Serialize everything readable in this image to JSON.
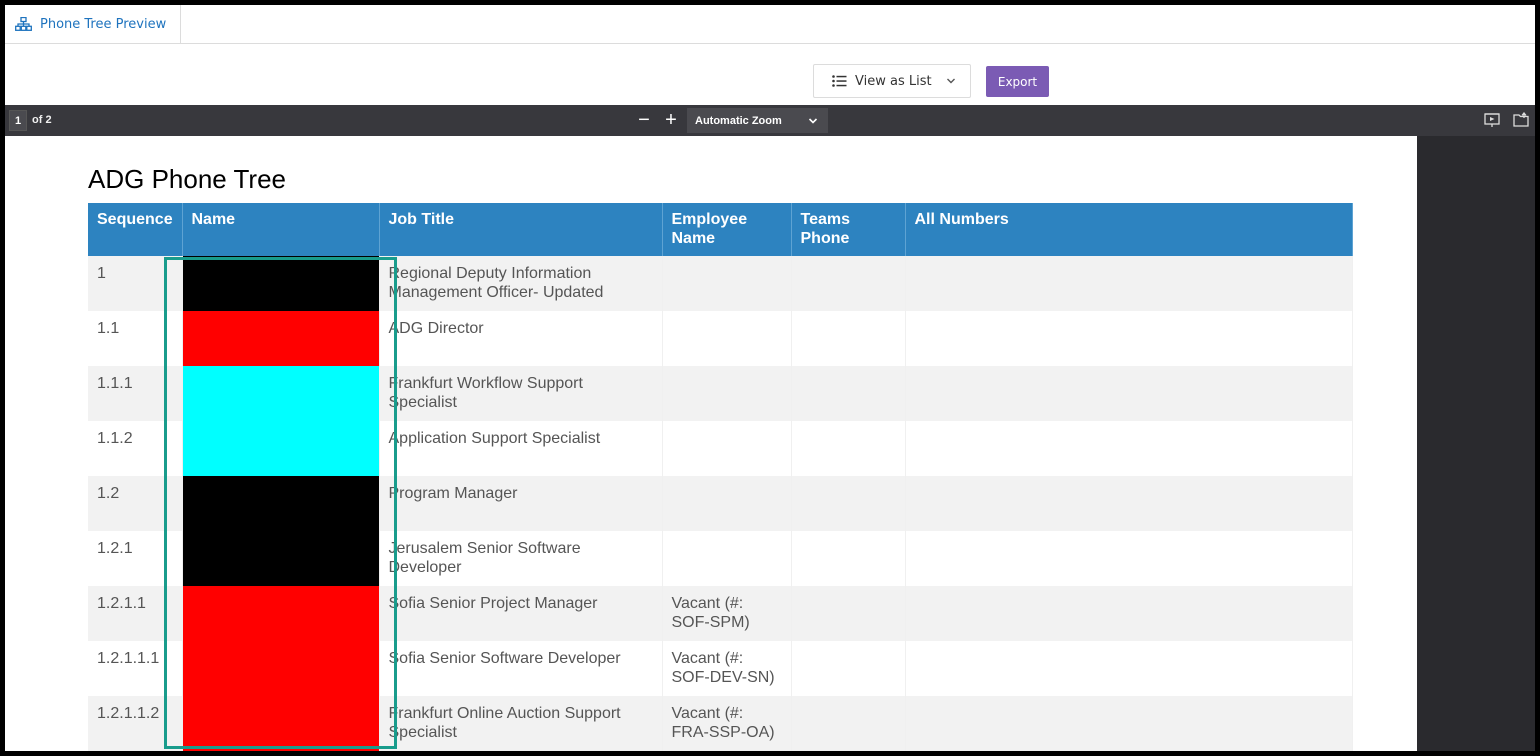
{
  "tab": {
    "label": "Phone Tree Preview",
    "icon": "hierarchy-icon"
  },
  "toolbar": {
    "view_select_label": "View as List",
    "export_label": "Export"
  },
  "pdf_toolbar": {
    "page_number": "1",
    "page_of": "of 2",
    "zoom_out": "−",
    "zoom_in": "+",
    "zoom_label": "Automatic Zoom"
  },
  "document": {
    "title": "ADG Phone Tree",
    "columns": [
      "Sequence",
      "Name",
      "Job Title",
      "Employee Name",
      "Teams Phone",
      "All Numbers"
    ],
    "rows": [
      {
        "sequence": "1",
        "name_redaction": "#000000",
        "job_title": "Regional Deputy Information Management Officer- Updated",
        "employee_name": "",
        "teams_phone": "",
        "all_numbers": ""
      },
      {
        "sequence": "1.1",
        "name_redaction": "#ff0000",
        "job_title": "ADG Director",
        "employee_name": "",
        "teams_phone": "",
        "all_numbers": ""
      },
      {
        "sequence": "1.1.1",
        "name_redaction": "#00ffff",
        "job_title": "Frankfurt Workflow Support Specialist",
        "employee_name": "",
        "teams_phone": "",
        "all_numbers": ""
      },
      {
        "sequence": "1.1.2",
        "name_redaction": "#00ffff",
        "job_title": "Application Support Specialist",
        "employee_name": "",
        "teams_phone": "",
        "all_numbers": ""
      },
      {
        "sequence": "1.2",
        "name_redaction": "#000000",
        "job_title": "Program Manager",
        "employee_name": "",
        "teams_phone": "",
        "all_numbers": ""
      },
      {
        "sequence": "1.2.1",
        "name_redaction": "#000000",
        "job_title": "Jerusalem Senior Software Developer",
        "employee_name": "",
        "teams_phone": "",
        "all_numbers": ""
      },
      {
        "sequence": "1.2.1.1",
        "name_redaction": "#ff0000",
        "job_title": "Sofia Senior Project Manager",
        "employee_name": "Vacant (#: SOF-SPM)",
        "teams_phone": "",
        "all_numbers": ""
      },
      {
        "sequence": "1.2.1.1.1",
        "name_redaction": "#ff0000",
        "job_title": "Sofia Senior Software Developer",
        "employee_name": "Vacant (#: SOF-DEV-SN)",
        "teams_phone": "",
        "all_numbers": ""
      },
      {
        "sequence": "1.2.1.1.2",
        "name_redaction": "#ff0000",
        "job_title": "Frankfurt Online Auction Support Specialist",
        "employee_name": "Vacant (#: FRA-SSP-OA)",
        "teams_phone": "",
        "all_numbers": ""
      }
    ]
  },
  "colors": {
    "accent": "#1e73be",
    "export_button": "#7b5bb4",
    "table_header": "#2d83c0",
    "highlight_box": "#199c8c",
    "pdf_toolbar": "#38383d"
  }
}
